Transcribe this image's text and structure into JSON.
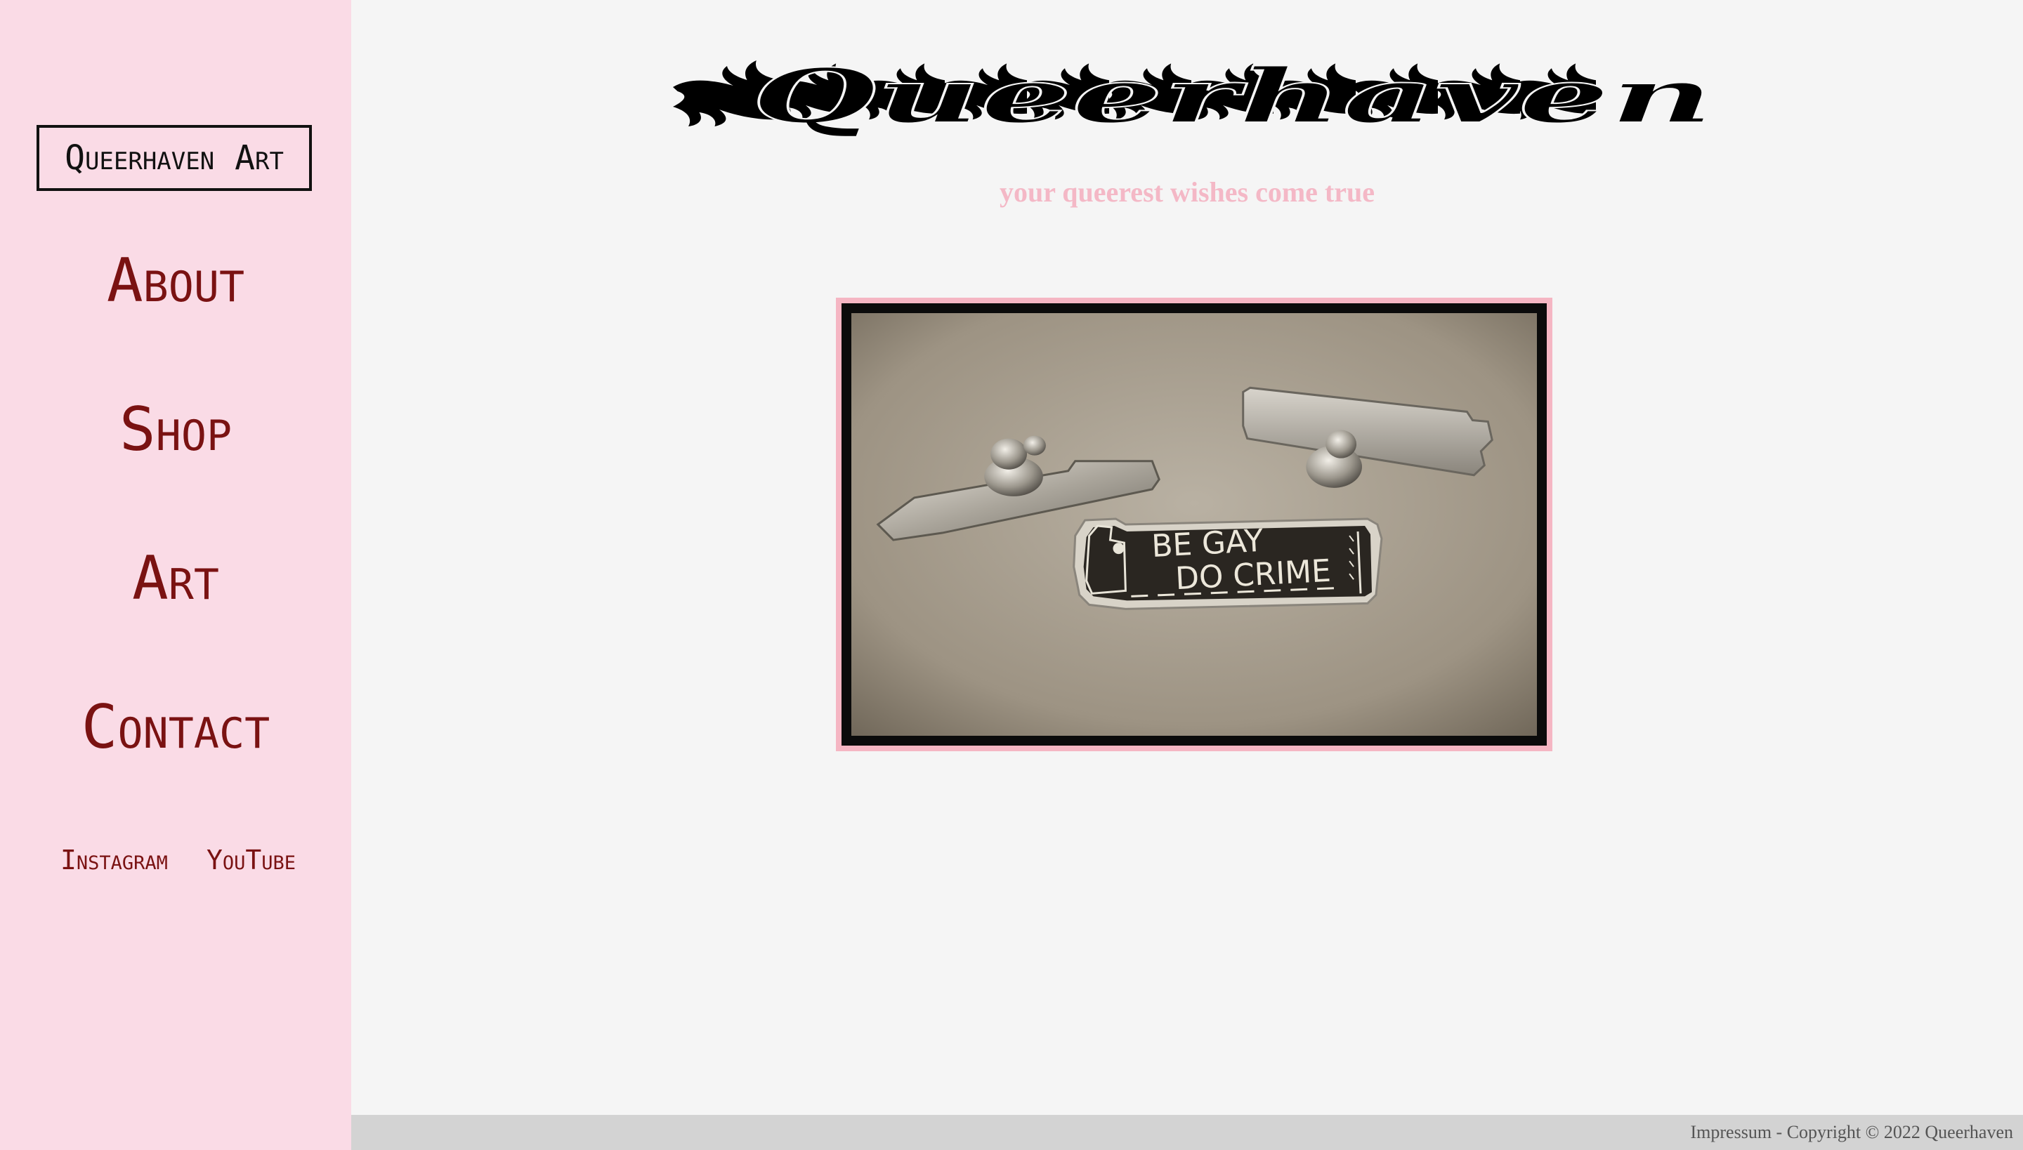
{
  "sidebar": {
    "brand": "Queerhaven Art",
    "nav": [
      "About",
      "Shop",
      "Art",
      "Contact"
    ],
    "social": [
      "Instagram",
      "YouTube"
    ]
  },
  "header": {
    "logo_text": "Queerhaven",
    "tagline": "your queerest wishes come true"
  },
  "hero": {
    "pin_line1": "BE GAY",
    "pin_line2": "DO CRIME"
  },
  "footer": {
    "text": "Impressum - Copyright © 2022 Queerhaven"
  },
  "colors": {
    "sidebar_bg": "#fadbe6",
    "nav_text": "#7a1212",
    "tagline": "#f4b8c6",
    "frame": "#f5b6c3",
    "page_bg": "#f5f5f5",
    "footer_bg": "#d3d3d3"
  }
}
